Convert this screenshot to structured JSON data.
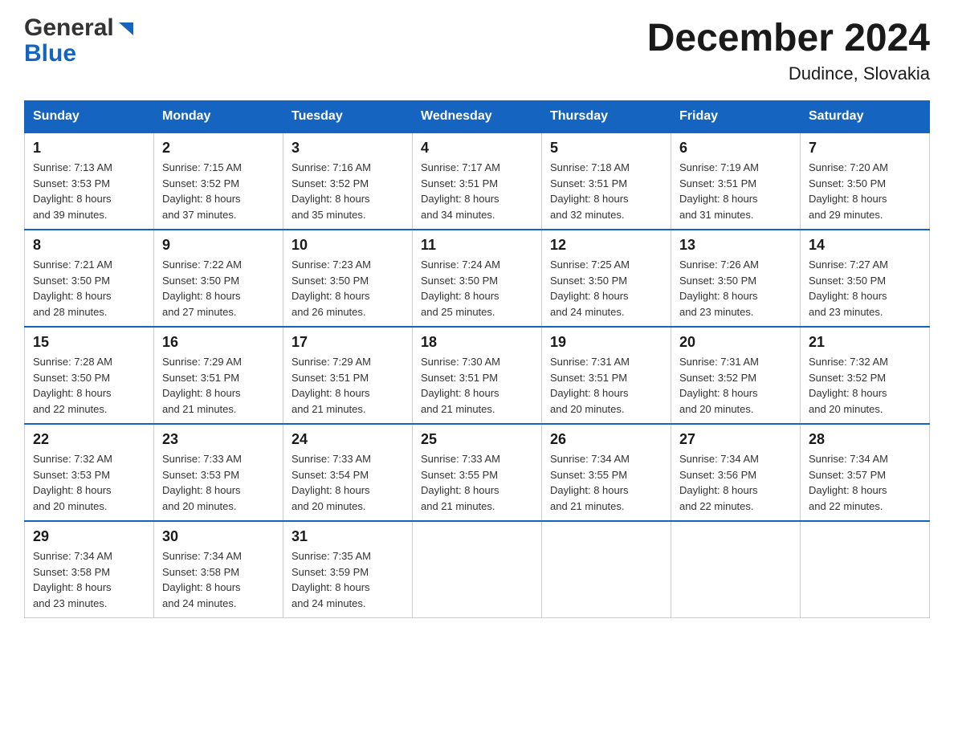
{
  "header": {
    "title": "December 2024",
    "subtitle": "Dudince, Slovakia",
    "logo_general": "General",
    "logo_blue": "Blue"
  },
  "days_of_week": [
    "Sunday",
    "Monday",
    "Tuesday",
    "Wednesday",
    "Thursday",
    "Friday",
    "Saturday"
  ],
  "weeks": [
    [
      {
        "day": "1",
        "sunrise": "7:13 AM",
        "sunset": "3:53 PM",
        "daylight": "8 hours and 39 minutes."
      },
      {
        "day": "2",
        "sunrise": "7:15 AM",
        "sunset": "3:52 PM",
        "daylight": "8 hours and 37 minutes."
      },
      {
        "day": "3",
        "sunrise": "7:16 AM",
        "sunset": "3:52 PM",
        "daylight": "8 hours and 35 minutes."
      },
      {
        "day": "4",
        "sunrise": "7:17 AM",
        "sunset": "3:51 PM",
        "daylight": "8 hours and 34 minutes."
      },
      {
        "day": "5",
        "sunrise": "7:18 AM",
        "sunset": "3:51 PM",
        "daylight": "8 hours and 32 minutes."
      },
      {
        "day": "6",
        "sunrise": "7:19 AM",
        "sunset": "3:51 PM",
        "daylight": "8 hours and 31 minutes."
      },
      {
        "day": "7",
        "sunrise": "7:20 AM",
        "sunset": "3:50 PM",
        "daylight": "8 hours and 29 minutes."
      }
    ],
    [
      {
        "day": "8",
        "sunrise": "7:21 AM",
        "sunset": "3:50 PM",
        "daylight": "8 hours and 28 minutes."
      },
      {
        "day": "9",
        "sunrise": "7:22 AM",
        "sunset": "3:50 PM",
        "daylight": "8 hours and 27 minutes."
      },
      {
        "day": "10",
        "sunrise": "7:23 AM",
        "sunset": "3:50 PM",
        "daylight": "8 hours and 26 minutes."
      },
      {
        "day": "11",
        "sunrise": "7:24 AM",
        "sunset": "3:50 PM",
        "daylight": "8 hours and 25 minutes."
      },
      {
        "day": "12",
        "sunrise": "7:25 AM",
        "sunset": "3:50 PM",
        "daylight": "8 hours and 24 minutes."
      },
      {
        "day": "13",
        "sunrise": "7:26 AM",
        "sunset": "3:50 PM",
        "daylight": "8 hours and 23 minutes."
      },
      {
        "day": "14",
        "sunrise": "7:27 AM",
        "sunset": "3:50 PM",
        "daylight": "8 hours and 23 minutes."
      }
    ],
    [
      {
        "day": "15",
        "sunrise": "7:28 AM",
        "sunset": "3:50 PM",
        "daylight": "8 hours and 22 minutes."
      },
      {
        "day": "16",
        "sunrise": "7:29 AM",
        "sunset": "3:51 PM",
        "daylight": "8 hours and 21 minutes."
      },
      {
        "day": "17",
        "sunrise": "7:29 AM",
        "sunset": "3:51 PM",
        "daylight": "8 hours and 21 minutes."
      },
      {
        "day": "18",
        "sunrise": "7:30 AM",
        "sunset": "3:51 PM",
        "daylight": "8 hours and 21 minutes."
      },
      {
        "day": "19",
        "sunrise": "7:31 AM",
        "sunset": "3:51 PM",
        "daylight": "8 hours and 20 minutes."
      },
      {
        "day": "20",
        "sunrise": "7:31 AM",
        "sunset": "3:52 PM",
        "daylight": "8 hours and 20 minutes."
      },
      {
        "day": "21",
        "sunrise": "7:32 AM",
        "sunset": "3:52 PM",
        "daylight": "8 hours and 20 minutes."
      }
    ],
    [
      {
        "day": "22",
        "sunrise": "7:32 AM",
        "sunset": "3:53 PM",
        "daylight": "8 hours and 20 minutes."
      },
      {
        "day": "23",
        "sunrise": "7:33 AM",
        "sunset": "3:53 PM",
        "daylight": "8 hours and 20 minutes."
      },
      {
        "day": "24",
        "sunrise": "7:33 AM",
        "sunset": "3:54 PM",
        "daylight": "8 hours and 20 minutes."
      },
      {
        "day": "25",
        "sunrise": "7:33 AM",
        "sunset": "3:55 PM",
        "daylight": "8 hours and 21 minutes."
      },
      {
        "day": "26",
        "sunrise": "7:34 AM",
        "sunset": "3:55 PM",
        "daylight": "8 hours and 21 minutes."
      },
      {
        "day": "27",
        "sunrise": "7:34 AM",
        "sunset": "3:56 PM",
        "daylight": "8 hours and 22 minutes."
      },
      {
        "day": "28",
        "sunrise": "7:34 AM",
        "sunset": "3:57 PM",
        "daylight": "8 hours and 22 minutes."
      }
    ],
    [
      {
        "day": "29",
        "sunrise": "7:34 AM",
        "sunset": "3:58 PM",
        "daylight": "8 hours and 23 minutes."
      },
      {
        "day": "30",
        "sunrise": "7:34 AM",
        "sunset": "3:58 PM",
        "daylight": "8 hours and 24 minutes."
      },
      {
        "day": "31",
        "sunrise": "7:35 AM",
        "sunset": "3:59 PM",
        "daylight": "8 hours and 24 minutes."
      },
      null,
      null,
      null,
      null
    ]
  ],
  "labels": {
    "sunrise_prefix": "Sunrise: ",
    "sunset_prefix": "Sunset: ",
    "daylight_prefix": "Daylight: "
  }
}
